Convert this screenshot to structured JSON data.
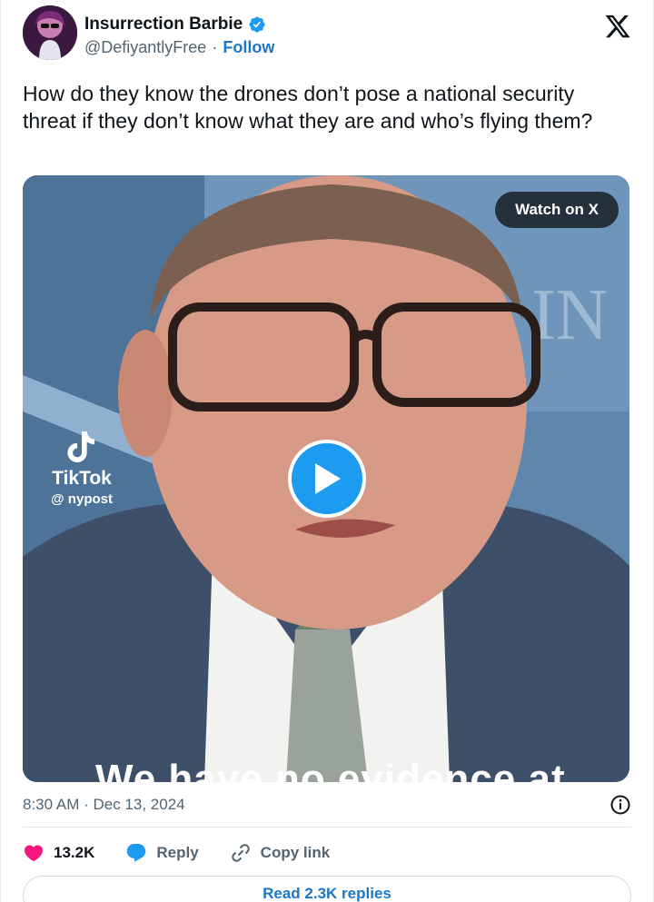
{
  "author": {
    "display_name": "Insurrection Barbie",
    "handle": "@DefiyantlyFree",
    "separator": "·",
    "follow_label": "Follow",
    "verified_icon": "verified-badge-icon",
    "avatar": "avatar"
  },
  "tweet": {
    "text": "How do they know the drones don’t pose a national security threat if they don’t know what they are and who’s flying them?"
  },
  "media": {
    "watch_label": "Watch on X",
    "play_icon": "play-icon",
    "watermark_brand": "TikTok",
    "watermark_handle": "@ nypost",
    "caption": "We have no evidence at"
  },
  "meta": {
    "timestamp": "8:30 AM · Dec 13, 2024",
    "info_icon": "info-icon"
  },
  "actions": {
    "likes": "13.2K",
    "reply_label": "Reply",
    "copy_link_label": "Copy link"
  },
  "read_replies_label": "Read 2.3K replies",
  "colors": {
    "accent": "#1d9bf0",
    "link": "#1d77c9",
    "like": "#f91880",
    "muted": "#536471"
  }
}
